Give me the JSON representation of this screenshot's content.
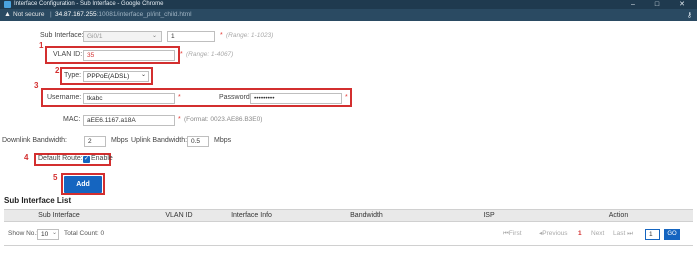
{
  "window": {
    "title": "Interface Configuration - Sub Interface - Google Chrome",
    "minimize": "–",
    "maximize": "□",
    "close": "✕"
  },
  "address_bar": {
    "security": "Not secure",
    "separator": "|",
    "host": "34.87.167.255",
    "path": ":10081/interface_pl/int_child.html"
  },
  "form": {
    "sub_interface": {
      "label": "Sub Interface:",
      "select_value": "Gi0/1",
      "value": "1",
      "required": "*",
      "hint": "(Range: 1-1023)"
    },
    "vlan_id": {
      "label": "VLAN ID:",
      "value": "35",
      "required": "*",
      "hint": "(Range: 1-4067)"
    },
    "type": {
      "label": "Type:",
      "value": "PPPoE(ADSL)"
    },
    "username": {
      "label": "Username:",
      "value": "tkabc",
      "required": "*"
    },
    "password": {
      "label": "Password:",
      "value": "•••••••••",
      "required": "*"
    },
    "mac": {
      "label": "MAC:",
      "value": "aEE6.1167.a18A",
      "required": "*",
      "hint": "(Format: 0023.AE86.B3E0)"
    },
    "bandwidth": {
      "downlink_label": "Downlink Bandwidth:",
      "downlink_value": "2",
      "downlink_unit": "Mbps",
      "uplink_label": "Uplink Bandwidth:",
      "uplink_value": "0.5",
      "uplink_unit": "Mbps"
    },
    "default_route": {
      "label": "Default Route:",
      "checkbox_label": "Enable",
      "checked": true
    },
    "add_button": "Add"
  },
  "annotations": [
    "1",
    "2",
    "3",
    "4",
    "5"
  ],
  "list": {
    "title": "Sub Interface List",
    "columns": [
      "Sub Interface",
      "VLAN ID",
      "Interface Info",
      "Bandwidth",
      "ISP",
      "Action"
    ],
    "show_no_label": "Show No.:",
    "show_no_value": "10",
    "total_count": "Total Count: 0",
    "pager": {
      "first": "First",
      "previous": "Previous",
      "current": "1",
      "next": "Next",
      "last": "Last",
      "page_input": "1",
      "go": "GO"
    }
  },
  "colors": {
    "annotation_red": "#d32f2f",
    "button_blue": "#1565c0",
    "titlebar": "#1f3a4f"
  }
}
